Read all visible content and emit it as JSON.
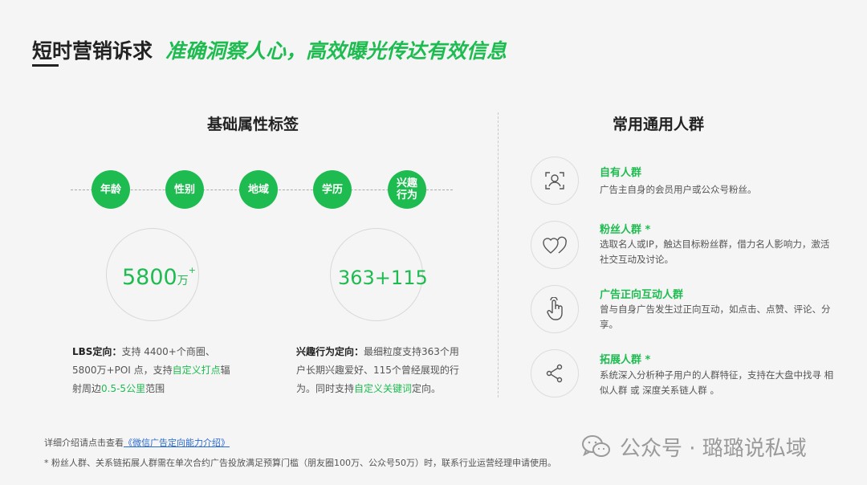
{
  "header": {
    "title": "短时营销诉求",
    "subtitle": "准确洞察人心，高效曝光传达有效信息"
  },
  "left": {
    "heading": "基础属性标签",
    "tags": [
      "年龄",
      "性别",
      "地域",
      "学历",
      "兴趣行为"
    ],
    "stat_lbs": {
      "number": "5800",
      "unit": "万",
      "sup": "+"
    },
    "stat_interest": {
      "number": "363+115"
    },
    "lbs_desc": {
      "label": "LBS定向",
      "colon": "：",
      "t1": "支持 4400+个商圈、5800万+POI 点，支持",
      "h1": "自定义打点",
      "t2": "辐射周边",
      "h2": "0.5-5公里",
      "t3": "范围"
    },
    "interest_desc": {
      "label": "兴趣行为定向",
      "colon": "：",
      "t1": "最细粒度支持363个用户长期兴趣爱好、115个曾经展现的行为。同时支持",
      "h1": "自定义关键词",
      "t2": "定向。"
    }
  },
  "right": {
    "heading": "常用通用人群",
    "items": [
      {
        "title": "自有人群",
        "desc": "广告主自身的会员用户或公众号粉丝。",
        "icon": "user-scan-icon"
      },
      {
        "title": "粉丝人群 *",
        "desc": "选取名人或IP，触达目标粉丝群，借力名人影响力，激活社交互动及讨论。",
        "icon": "hearts-icon"
      },
      {
        "title": "广告正向互动人群",
        "desc": "曾与自身广告发生过正向互动，如点击、点赞、评论、分享。",
        "icon": "hand-tap-icon"
      },
      {
        "title": "拓展人群 *",
        "desc": "系统深入分析种子用户的人群特征，支持在大盘中找寻 相似人群 或 深度关系链人群 。",
        "icon": "share-icon"
      }
    ]
  },
  "footer": {
    "line1_prefix": "详细介绍请点击查看",
    "line1_link": "《微信广告定向能力介绍》",
    "line2": "* 粉丝人群、关系链拓展人群需在单次合约广告投放满足预算门槛（朋友圈100万、公众号50万）时，联系行业运营经理申请使用。"
  },
  "watermark": {
    "text": "公众号 · 璐璐说私域",
    "icon": "wechat-icon"
  },
  "colors": {
    "accent": "#1ebc50",
    "link": "#2a6bd1"
  }
}
